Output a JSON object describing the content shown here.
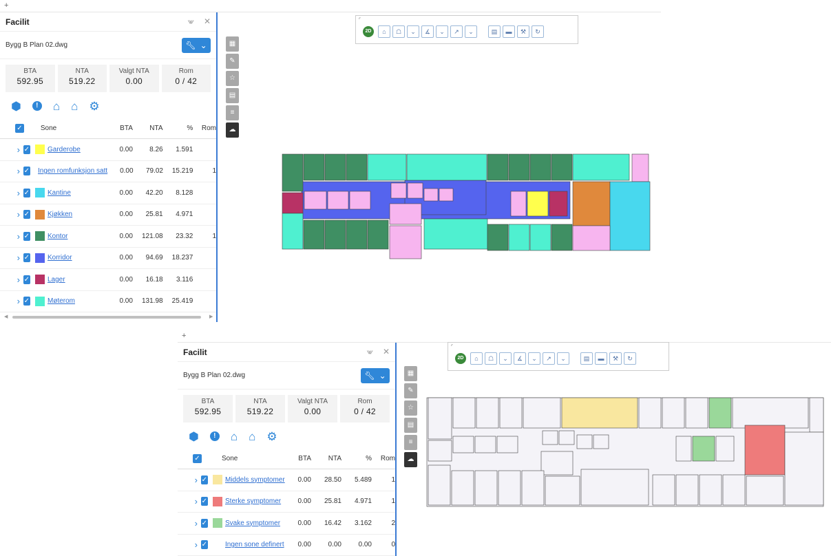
{
  "panel_top": {
    "title": "Facilit",
    "file_name": "Bygg B Plan 02.dwg",
    "stats": [
      {
        "label": "BTA",
        "value": "592.95"
      },
      {
        "label": "NTA",
        "value": "519.22"
      },
      {
        "label": "Valgt NTA",
        "value": "0.00"
      },
      {
        "label": "Rom",
        "value": "0 / 42"
      }
    ],
    "columns": {
      "zone": "Sone",
      "bta": "BTA",
      "nta": "NTA",
      "pct": "%",
      "rom": "Rom"
    },
    "rows": [
      {
        "name": "Garderobe",
        "color": "#ffff4d",
        "bta": "0.00",
        "nta": "8.26",
        "pct": "1.591",
        "rom": ""
      },
      {
        "name": "Ingen romfunksjon satt",
        "color": "#f7b5ef",
        "bta": "0.00",
        "nta": "79.02",
        "pct": "15.219",
        "rom": "1"
      },
      {
        "name": "Kantine",
        "color": "#48d8ee",
        "bta": "0.00",
        "nta": "42.20",
        "pct": "8.128",
        "rom": ""
      },
      {
        "name": "Kjøkken",
        "color": "#e0893c",
        "bta": "0.00",
        "nta": "25.81",
        "pct": "4.971",
        "rom": ""
      },
      {
        "name": "Kontor",
        "color": "#3f8f63",
        "bta": "0.00",
        "nta": "121.08",
        "pct": "23.32",
        "rom": "1"
      },
      {
        "name": "Korridor",
        "color": "#5564ee",
        "bta": "0.00",
        "nta": "94.69",
        "pct": "18.237",
        "rom": ""
      },
      {
        "name": "Lager",
        "color": "#b83265",
        "bta": "0.00",
        "nta": "16.18",
        "pct": "3.116",
        "rom": ""
      },
      {
        "name": "Møterom",
        "color": "#4ff0d0",
        "bta": "0.00",
        "nta": "131.98",
        "pct": "25.419",
        "rom": ""
      }
    ]
  },
  "panel_bottom": {
    "title": "Facilit",
    "file_name": "Bygg B Plan 02.dwg",
    "stats": [
      {
        "label": "BTA",
        "value": "592.95"
      },
      {
        "label": "NTA",
        "value": "519.22"
      },
      {
        "label": "Valgt NTA",
        "value": "0.00"
      },
      {
        "label": "Rom",
        "value": "0 / 42"
      }
    ],
    "columns": {
      "zone": "Sone",
      "bta": "BTA",
      "nta": "NTA",
      "pct": "%",
      "rom": "Rom"
    },
    "rows": [
      {
        "name": "Middels symptomer",
        "color": "#f9e79f",
        "bta": "0.00",
        "nta": "28.50",
        "pct": "5.489",
        "rom": "1"
      },
      {
        "name": "Sterke symptomer",
        "color": "#ee7b7b",
        "bta": "0.00",
        "nta": "25.81",
        "pct": "4.971",
        "rom": "1"
      },
      {
        "name": "Svake symptomer",
        "color": "#9ad89a",
        "bta": "0.00",
        "nta": "16.42",
        "pct": "3.162",
        "rom": "2"
      },
      {
        "name": "Ingen sone definert",
        "color": "",
        "bta": "0.00",
        "nta": "0.00",
        "pct": "0.00",
        "rom": "0"
      }
    ]
  },
  "toolbar": {
    "mode_badge": "2D"
  },
  "icons": {
    "cube": "cube-icon",
    "info": "info-icon",
    "house_gear": "house-settings-icon",
    "home": "home-icon",
    "settings": "gear-icon",
    "wrench": "wrench-icon",
    "pin": "pin-icon",
    "close": "close-icon",
    "expand": "chevron-right-icon"
  }
}
